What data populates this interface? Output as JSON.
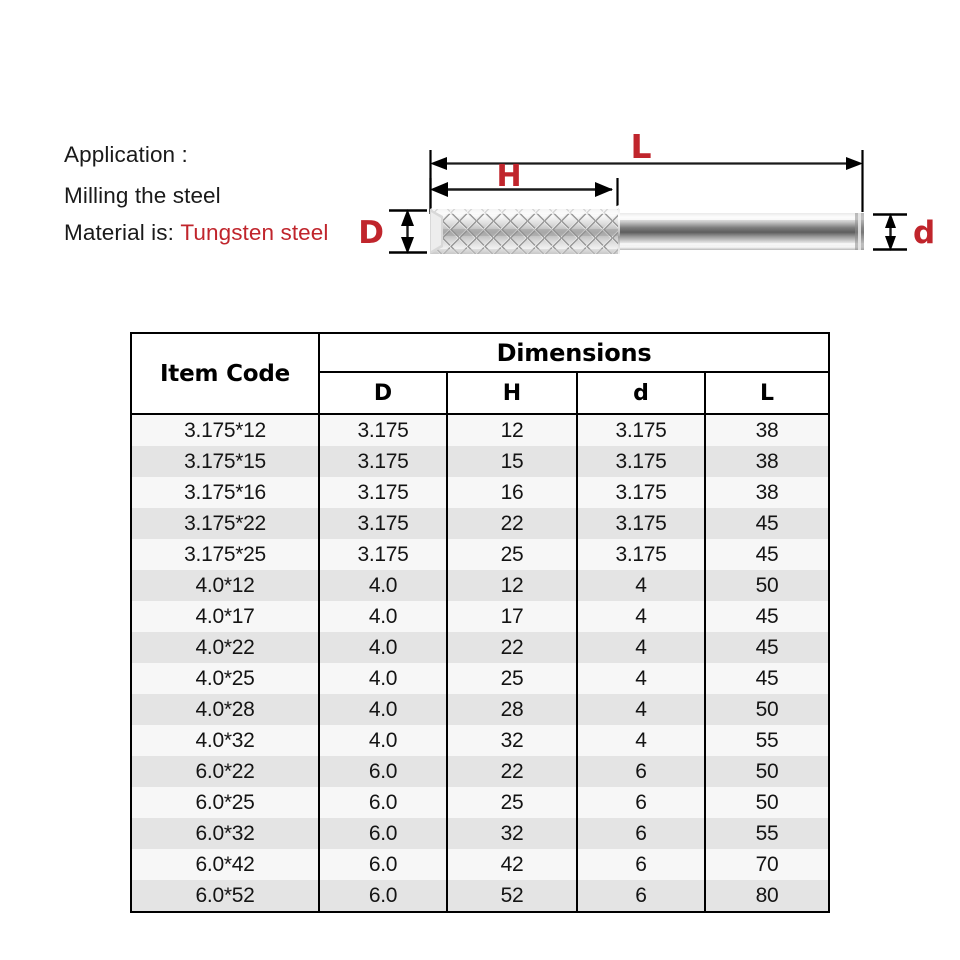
{
  "application": {
    "heading": "Application :",
    "usage": "Milling the steel",
    "material_label": "Material is:",
    "material_value": "Tungsten steel",
    "accent_color": "#C0252C"
  },
  "diagram": {
    "name": "carbide-end-mill-router-bit",
    "labels": {
      "overall_length": "L",
      "flute_length": "H",
      "cutting_diameter": "D",
      "shank_diameter": "d"
    },
    "label_color": "#C0252C",
    "dimension_line_color": "#000000"
  },
  "table": {
    "header": {
      "item_code": "Item Code",
      "dimensions": "Dimensions",
      "columns": [
        "D",
        "H",
        "d",
        "L"
      ]
    },
    "rows": [
      {
        "item_code": "3.175*12",
        "D": "3.175",
        "H": "12",
        "d": "3.175",
        "L": "38"
      },
      {
        "item_code": "3.175*15",
        "D": "3.175",
        "H": "15",
        "d": "3.175",
        "L": "38"
      },
      {
        "item_code": "3.175*16",
        "D": "3.175",
        "H": "16",
        "d": "3.175",
        "L": "38"
      },
      {
        "item_code": "3.175*22",
        "D": "3.175",
        "H": "22",
        "d": "3.175",
        "L": "45"
      },
      {
        "item_code": "3.175*25",
        "D": "3.175",
        "H": "25",
        "d": "3.175",
        "L": "45"
      },
      {
        "item_code": "4.0*12",
        "D": "4.0",
        "H": "12",
        "d": "4",
        "L": "50"
      },
      {
        "item_code": "4.0*17",
        "D": "4.0",
        "H": "17",
        "d": "4",
        "L": "45"
      },
      {
        "item_code": "4.0*22",
        "D": "4.0",
        "H": "22",
        "d": "4",
        "L": "45"
      },
      {
        "item_code": "4.0*25",
        "D": "4.0",
        "H": "25",
        "d": "4",
        "L": "45"
      },
      {
        "item_code": "4.0*28",
        "D": "4.0",
        "H": "28",
        "d": "4",
        "L": "50"
      },
      {
        "item_code": "4.0*32",
        "D": "4.0",
        "H": "32",
        "d": "4",
        "L": "55"
      },
      {
        "item_code": "6.0*22",
        "D": "6.0",
        "H": "22",
        "d": "6",
        "L": "50"
      },
      {
        "item_code": "6.0*25",
        "D": "6.0",
        "H": "25",
        "d": "6",
        "L": "50"
      },
      {
        "item_code": "6.0*32",
        "D": "6.0",
        "H": "32",
        "d": "6",
        "L": "55"
      },
      {
        "item_code": "6.0*42",
        "D": "6.0",
        "H": "42",
        "d": "6",
        "L": "70"
      },
      {
        "item_code": "6.0*52",
        "D": "6.0",
        "H": "52",
        "d": "6",
        "L": "80"
      }
    ]
  }
}
